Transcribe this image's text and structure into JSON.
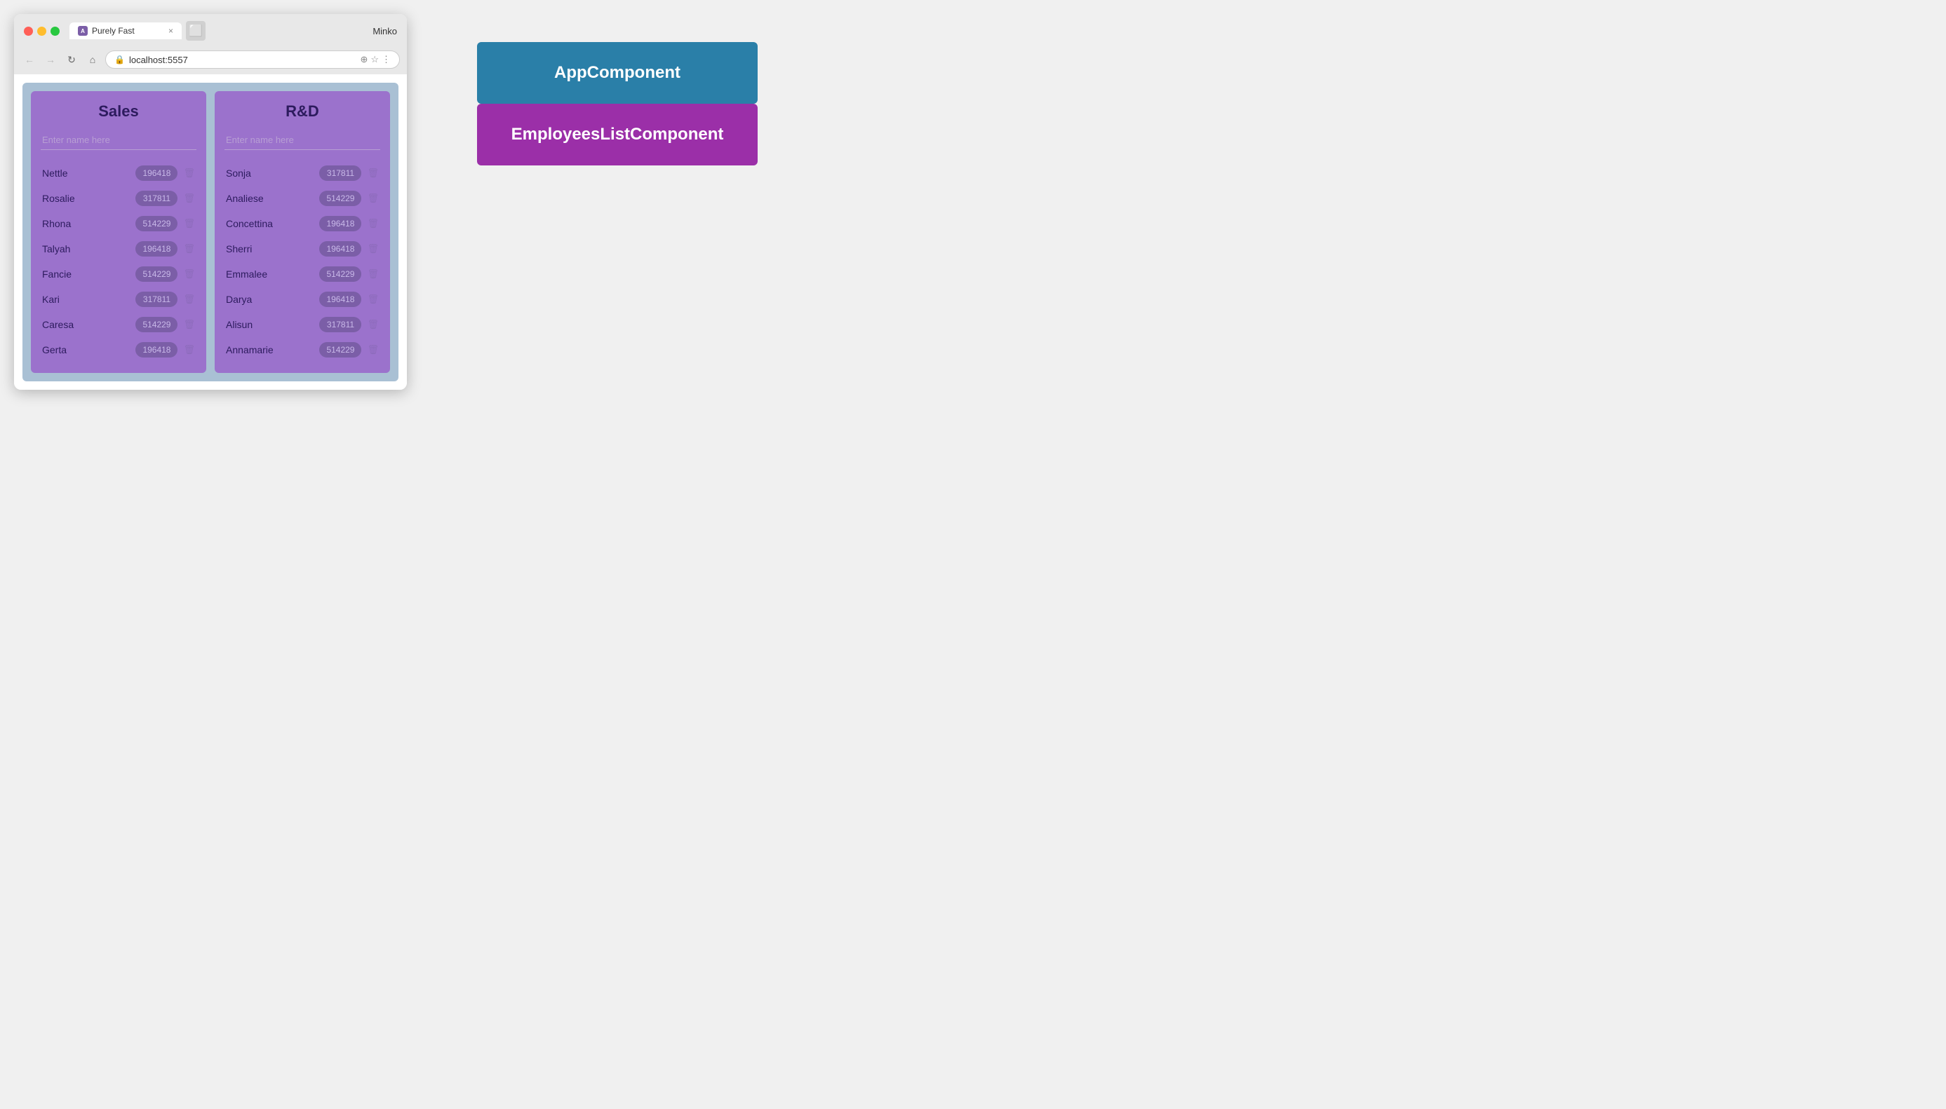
{
  "browser": {
    "tab_title": "Purely Fast",
    "tab_favicon": "A",
    "close_label": "×",
    "profile_name": "Minko",
    "url": "localhost:5557",
    "nav_back": "←",
    "nav_forward": "→",
    "nav_refresh": "↻",
    "nav_home": "⌂"
  },
  "departments": [
    {
      "title": "Sales",
      "placeholder": "Enter name here",
      "employees": [
        {
          "name": "Nettle",
          "badge": "196418"
        },
        {
          "name": "Rosalie",
          "badge": "317811"
        },
        {
          "name": "Rhona",
          "badge": "514229"
        },
        {
          "name": "Talyah",
          "badge": "196418"
        },
        {
          "name": "Fancie",
          "badge": "514229"
        },
        {
          "name": "Kari",
          "badge": "317811"
        },
        {
          "name": "Caresa",
          "badge": "514229"
        },
        {
          "name": "Gerta",
          "badge": "196418"
        }
      ]
    },
    {
      "title": "R&D",
      "placeholder": "Enter name here",
      "employees": [
        {
          "name": "Sonja",
          "badge": "317811"
        },
        {
          "name": "Analiese",
          "badge": "514229"
        },
        {
          "name": "Concettina",
          "badge": "196418"
        },
        {
          "name": "Sherri",
          "badge": "196418"
        },
        {
          "name": "Emmalee",
          "badge": "514229"
        },
        {
          "name": "Darya",
          "badge": "196418"
        },
        {
          "name": "Alisun",
          "badge": "317811"
        },
        {
          "name": "Annamarie",
          "badge": "514229"
        }
      ]
    }
  ],
  "diagram": {
    "app_component_label": "AppComponent",
    "employees_component_label": "EmployeesListComponent"
  }
}
